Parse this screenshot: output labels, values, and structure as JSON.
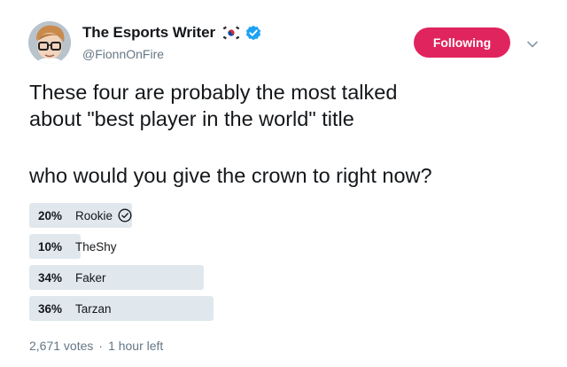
{
  "author": {
    "name": "The Esports Writer",
    "handle": "@FionnOnFire",
    "flag_icon": "south-korea-flag-icon",
    "verified_icon": "verified-badge-icon"
  },
  "actions": {
    "follow_label": "Following",
    "menu_icon": "chevron-down-icon"
  },
  "tweet": {
    "line1": "These four are probably the most talked",
    "line2": "about \"best player in the world\" title",
    "line3": "who would you give the crown to right now?"
  },
  "poll": {
    "options": [
      {
        "percent_label": "20%",
        "label": "Rookie",
        "percent": 20,
        "selected": true
      },
      {
        "percent_label": "10%",
        "label": "TheShy",
        "percent": 10,
        "selected": false
      },
      {
        "percent_label": "34%",
        "label": "Faker",
        "percent": 34,
        "selected": false
      },
      {
        "percent_label": "36%",
        "label": "Tarzan",
        "percent": 36,
        "selected": false
      }
    ],
    "votes": "2,671 votes",
    "separator": "·",
    "time_left": "1 hour left"
  },
  "colors": {
    "follow_button": "#e0245e",
    "verified": "#1da1f2",
    "poll_bar": "#e1e8ed",
    "secondary_text": "#657786"
  }
}
